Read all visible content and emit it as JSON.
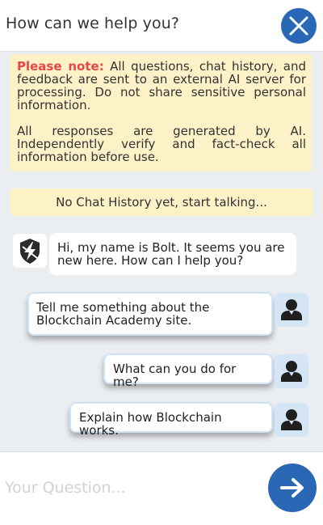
{
  "header": {
    "title": "How can we help you?"
  },
  "notice": {
    "label": "Please note:",
    "text1": "All questions, chat history, and feedback are sent to an external AI server for processing. Do not share sensitive personal information.",
    "text2": "All responses are generated by AI. Independently verify and fact-check all information before use."
  },
  "history": {
    "text": "No Chat History yet, start talking..."
  },
  "messages": {
    "bot": {
      "text": "Hi, my name is Bolt. It seems you are new here. How can I help you?",
      "icon": "bot-shield-icon"
    },
    "user": [
      {
        "text": "Tell me something about the Blockchain Academy site.",
        "icon": "user-icon"
      },
      {
        "text": "What can you do for me?",
        "icon": "user-icon"
      },
      {
        "text": "Explain how Blockchain works.",
        "icon": "user-icon"
      }
    ]
  },
  "input": {
    "placeholder": "Your Question..."
  },
  "icons": {
    "close": "close-icon",
    "send": "arrow-right-icon"
  },
  "colors": {
    "accent": "#2a68b6",
    "notice_bg": "#fdf1c8",
    "note_label": "#e8474a",
    "chat_bg": "#ebeef1",
    "user_avatar_bg": "#d4e6f6"
  }
}
